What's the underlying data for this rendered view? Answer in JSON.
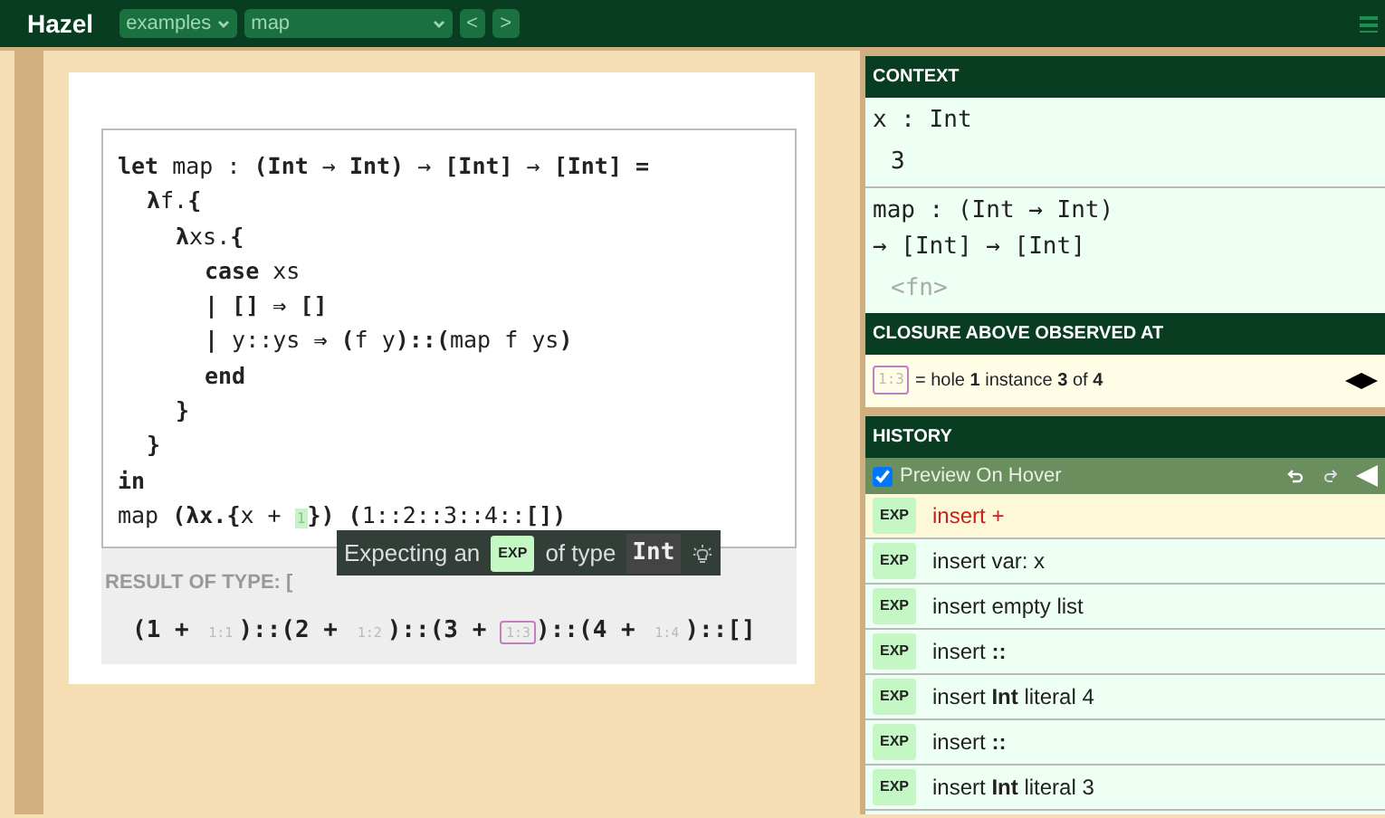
{
  "topbar": {
    "title": "Hazel",
    "example_select": "examples",
    "file_select": "map",
    "prev": "<",
    "next": ">"
  },
  "code_lines": [
    {
      "text": "**let** map : **(Int** → **Int)** → **[Int]** → **[Int] =**",
      "children": [
        {
          "text": "**λ**f.**{**",
          "children": [
            {
              "text": "**λ**xs.**{**",
              "children": [
                {
                  "text": "**case** xs"
                },
                {
                  "text": "**| [] ⇒ []**"
                },
                {
                  "text": "**|** y::ys **⇒ (**f y**)::(**map f ys**)**"
                },
                {
                  "text": "**end**"
                }
              ]
            },
            {
              "text": "**}**"
            }
          ]
        },
        {
          "text": "**}**"
        }
      ]
    },
    {
      "text": "**in**"
    }
  ],
  "last_line": {
    "before": "map **(λx.{**x + ",
    "hole": "1",
    "after": "**})** **(**1::2::3::4::**[])**"
  },
  "result": {
    "label": "RESULT OF TYPE:",
    "type": "[",
    "parts": [
      {
        "kind": "text",
        "text": "(1 + "
      },
      {
        "kind": "hole",
        "text": "1:1",
        "selected": false
      },
      {
        "kind": "text",
        "text": ")::(2 + "
      },
      {
        "kind": "hole",
        "text": "1:2",
        "selected": false
      },
      {
        "kind": "text",
        "text": ")::(3 + "
      },
      {
        "kind": "hole",
        "text": "1:3",
        "selected": true
      },
      {
        "kind": "text",
        "text": ")::(4 + "
      },
      {
        "kind": "hole",
        "text": "1:4",
        "selected": false
      },
      {
        "kind": "text",
        "text": ")::[]"
      }
    ]
  },
  "tooltip": {
    "before": "Expecting an",
    "badge": "EXP",
    "middle": "of type",
    "type": "Int"
  },
  "context": {
    "title": "CONTEXT",
    "entries": [
      {
        "binding": "x : Int",
        "value": "3"
      },
      {
        "binding": "map : (Int → Int) → [Int] → [Int]",
        "value": "<fn>"
      }
    ]
  },
  "closure": {
    "title": "CLOSURE ABOVE OBSERVED AT",
    "hole": "1:3",
    "text": "= hole **1** instance **3** of **4**"
  },
  "history": {
    "title": "HISTORY",
    "preview_on_hover": {
      "label": "Preview On Hover",
      "checked": true
    },
    "items": [
      {
        "badge": "EXP",
        "text": "insert +",
        "selected": true
      },
      {
        "badge": "EXP",
        "text": "insert var: x",
        "selected": false
      },
      {
        "badge": "EXP",
        "text": "insert empty list",
        "selected": false
      },
      {
        "badge": "EXP",
        "text": "insert **::**",
        "selected": false
      },
      {
        "badge": "EXP",
        "text": "insert **Int** literal 4",
        "selected": false
      },
      {
        "badge": "EXP",
        "text": "insert **::**",
        "selected": false
      },
      {
        "badge": "EXP",
        "text": "insert **Int** literal 3",
        "selected": false
      }
    ]
  }
}
